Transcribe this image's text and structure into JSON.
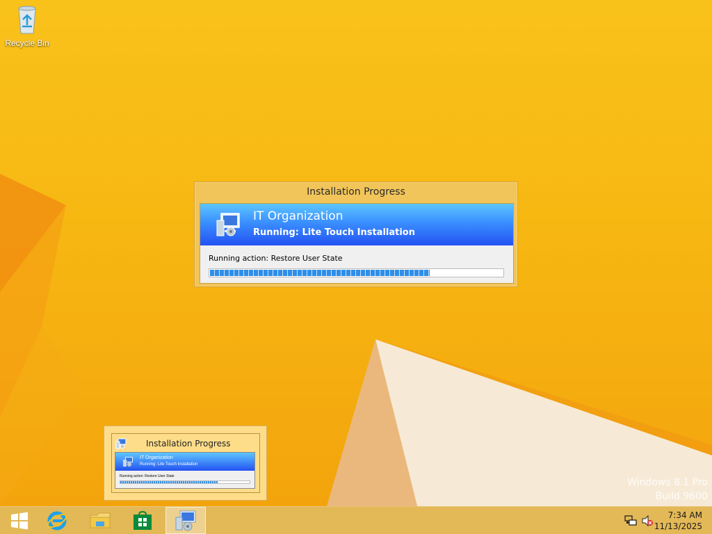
{
  "desktop": {
    "recycle_bin_label": "Recycle Bin",
    "watermark_line1": "Windows 8.1 Pro",
    "watermark_line2": "Build 9600"
  },
  "dialog": {
    "title": "Installation Progress",
    "organization": "IT Organization",
    "running": "Running: Lite Touch Installation",
    "action": "Running action: Restore User State",
    "progress_fraction": 0.75
  },
  "thumbnail": {
    "title": "Installation Progress",
    "organization": "IT Organization",
    "running": "Running: Lite Touch Installation",
    "action": "Running action: Restore User State"
  },
  "taskbar": {
    "items": [
      "start",
      "internet-explorer",
      "file-explorer",
      "store",
      "installation-progress"
    ],
    "time": "7:34 AM",
    "date": "11/13/2025"
  },
  "colors": {
    "wallpaper": "#f7b712",
    "banner_top": "#5ec6ff",
    "banner_bottom": "#2352f2",
    "progress": "#2f8ee8"
  }
}
